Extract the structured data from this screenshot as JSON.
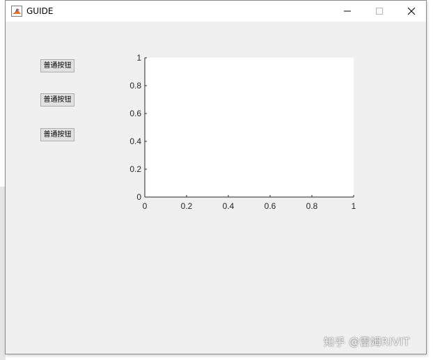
{
  "window": {
    "title": "GUIDE"
  },
  "buttons": [
    {
      "label": "普通按钮"
    },
    {
      "label": "普通按钮"
    },
    {
      "label": "普通按钮"
    }
  ],
  "chart_data": {
    "type": "line",
    "series": [],
    "xlim": [
      0,
      1
    ],
    "ylim": [
      0,
      1
    ],
    "xticks": [
      "0",
      "0.2",
      "0.4",
      "0.6",
      "0.8",
      "1"
    ],
    "yticks": [
      "0",
      "0.2",
      "0.4",
      "0.6",
      "0.8",
      "1"
    ],
    "grid": false
  },
  "watermark": "知乎 @雷姆RIVIT"
}
